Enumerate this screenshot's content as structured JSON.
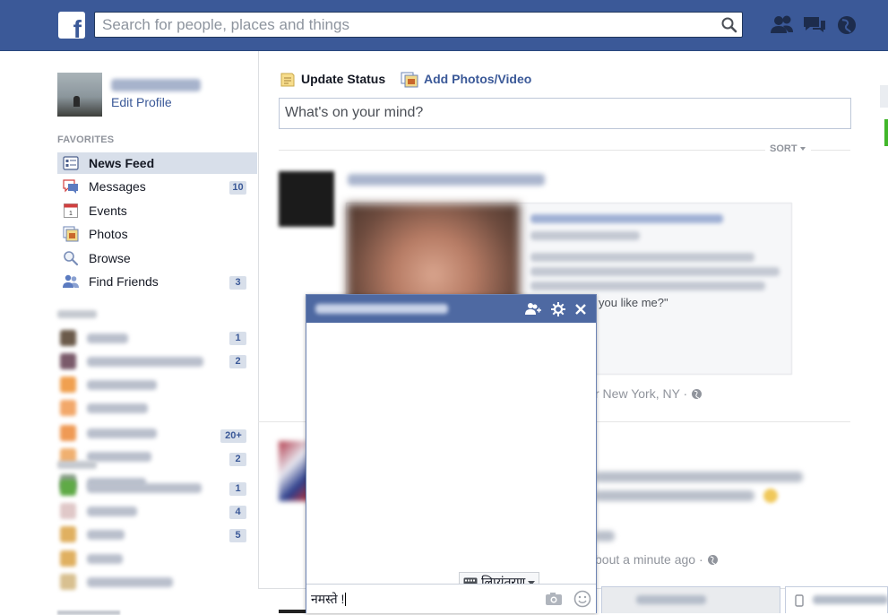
{
  "header": {
    "logo_letter": "f",
    "search_placeholder": "Search for people, places and things"
  },
  "sidebar": {
    "edit_profile": "Edit Profile",
    "favorites_heading": "FAVORITES",
    "favorites": [
      {
        "label": "News Feed",
        "icon": "news-feed-icon"
      },
      {
        "label": "Messages",
        "icon": "messages-icon",
        "badge": "10"
      },
      {
        "label": "Events",
        "icon": "calendar-icon"
      },
      {
        "label": "Photos",
        "icon": "photos-icon"
      },
      {
        "label": "Browse",
        "icon": "magnifier-icon"
      },
      {
        "label": "Find Friends",
        "icon": "friends-icon",
        "badge": "3"
      }
    ],
    "pages_badges": [
      "1",
      "2",
      "20+",
      "2"
    ],
    "groups_badges": [
      "1",
      "4",
      "5"
    ]
  },
  "composer": {
    "update_status": "Update Status",
    "add_photos": "Add Photos/Video",
    "placeholder": "What's on your mind?",
    "sort_label": "SORT"
  },
  "feed": {
    "story1_card_text": "you like me?\"",
    "story1_location": "r New York, NY ·",
    "story2_time": "bout a minute ago ·"
  },
  "chat": {
    "input_text": "नमस्ते !",
    "transliteration_label": "लिप्यंतरण"
  },
  "colors": {
    "brand": "#3b5998",
    "chat_header": "#4e69a2",
    "badge_bg": "#d8dfea"
  }
}
